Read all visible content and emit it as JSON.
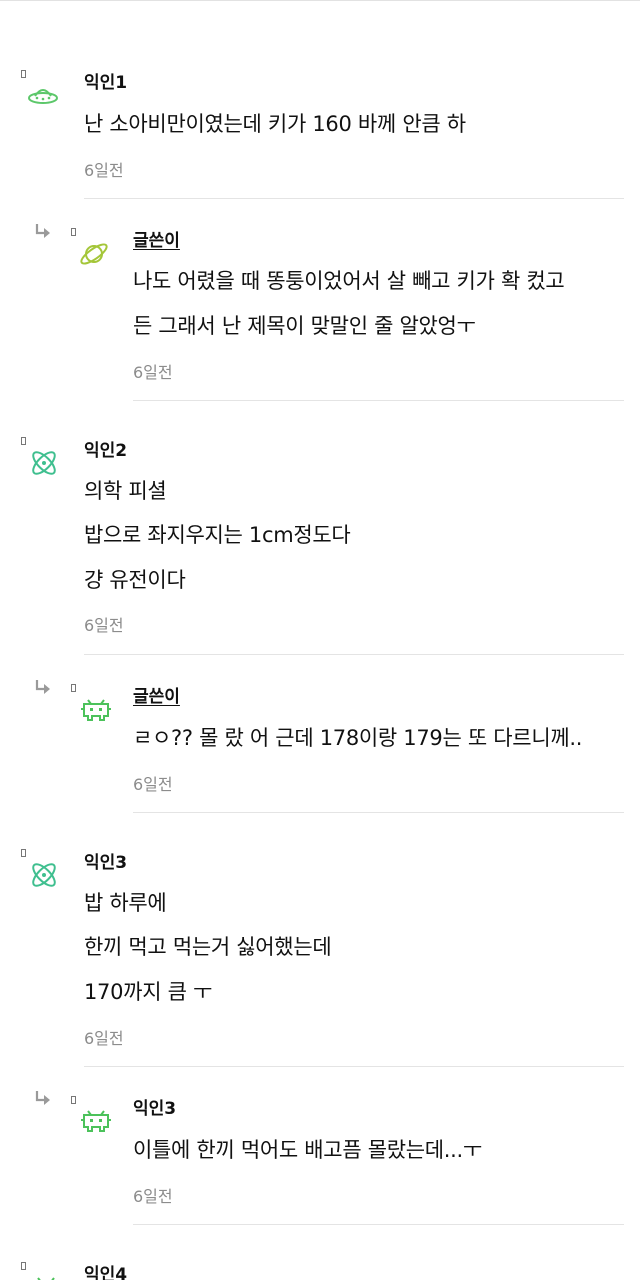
{
  "comments": [
    {
      "name": "익인1",
      "lines": [
        "난 소아비만이였는데 키가 160 바께 안큼 하"
      ],
      "time": "6일전"
    },
    {
      "name": "글쓴이",
      "lines": [
        "나도 어렸을 때 똥퉁이었어서 살 빼고 키가 확 컸고",
        "든 그래서 난 제목이 맞말인 줄 알았엉ㅜ"
      ],
      "time": "6일전"
    },
    {
      "name": "익인2",
      "lines": [
        "의학 피셜",
        "밥으로 좌지우지는 1cm정도다",
        "걍 유전이다"
      ],
      "time": "6일전"
    },
    {
      "name": "글쓴이",
      "lines": [
        "ㄹㅇ?? 몰 랐 어 근데 178이랑 179는 또 다르니께.."
      ],
      "time": "6일전"
    },
    {
      "name": "익인3",
      "lines": [
        "밥 하루에",
        "한끼 먹고 먹는거 싫어했는데",
        "170까지 큼 ㅜ"
      ],
      "time": "6일전"
    },
    {
      "name": "익인3",
      "lines": [
        "이틀에 한끼 먹어도 배고픔 몰랐는데...ㅜ"
      ],
      "time": "6일전"
    },
    {
      "name": "익인4"
    }
  ],
  "icons": {
    "avatar_1": "ufo-icon",
    "avatar_2": "planet-icon",
    "avatar_3": "atom-icon",
    "avatar_4": "space-invader-icon",
    "avatar_5": "atom-icon",
    "avatar_6": "space-invader-icon",
    "avatar_7": "space-invader-icon",
    "reply": "reply-arrow-icon"
  },
  "colors": {
    "ufo": "#5cc76a",
    "planet": "#a4c639",
    "atom": "#3fbf8f",
    "invader": "#4cc25b"
  }
}
